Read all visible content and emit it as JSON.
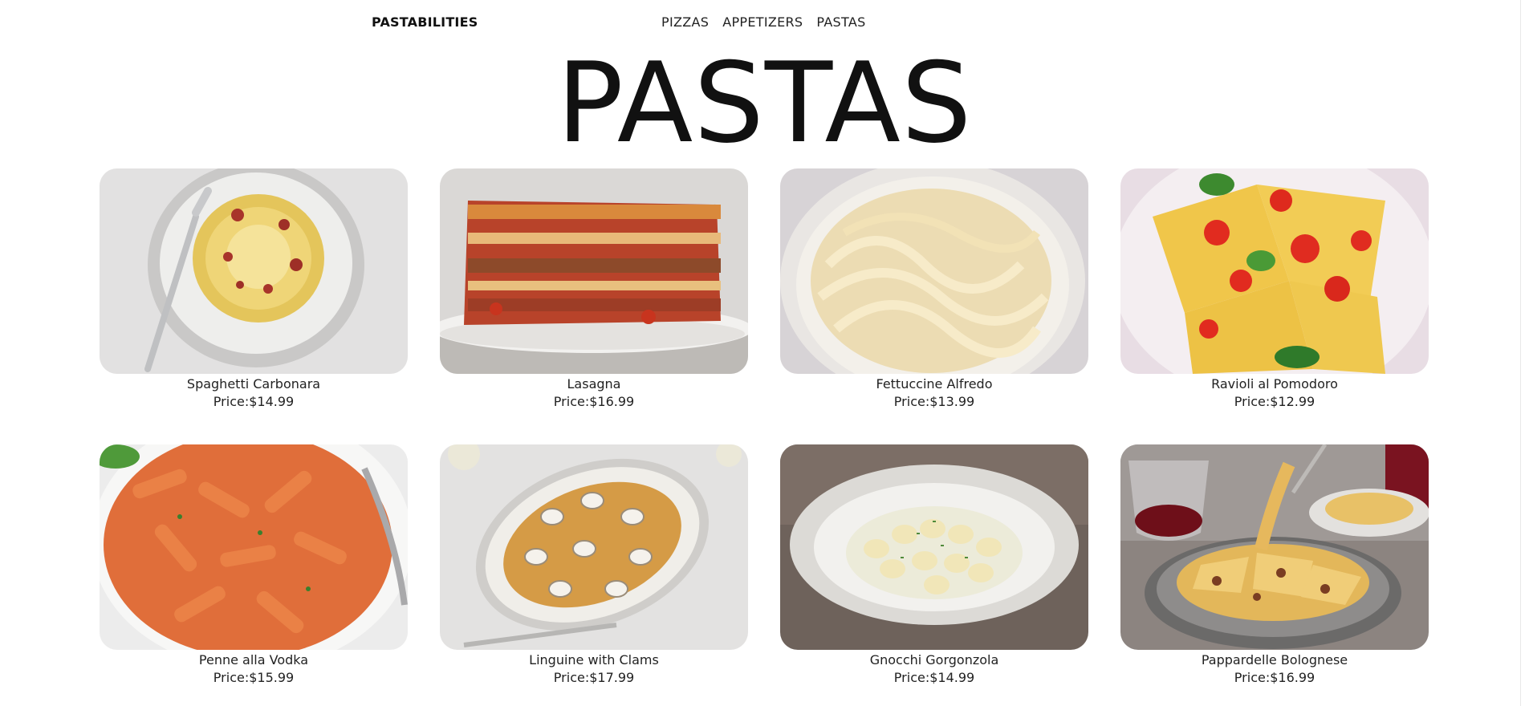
{
  "nav": {
    "brand": "PASTABILITIES",
    "links": [
      "PIZZAS",
      "APPETIZERS",
      "PASTAS"
    ]
  },
  "page": {
    "title": "PASTAS"
  },
  "dishes": [
    {
      "name": "Spaghetti Carbonara",
      "price": "Price:$14.99",
      "image": "spaghetti-carbonara-photo"
    },
    {
      "name": "Lasagna",
      "price": "Price:$16.99",
      "image": "lasagna-photo"
    },
    {
      "name": "Fettuccine Alfredo",
      "price": "Price:$13.99",
      "image": "fettuccine-alfredo-photo"
    },
    {
      "name": "Ravioli al Pomodoro",
      "price": "Price:$12.99",
      "image": "ravioli-pomodoro-photo"
    },
    {
      "name": "Penne alla Vodka",
      "price": "Price:$15.99",
      "image": "penne-vodka-photo"
    },
    {
      "name": "Linguine with Clams",
      "price": "Price:$17.99",
      "image": "linguine-clams-photo"
    },
    {
      "name": "Gnocchi Gorgonzola",
      "price": "Price:$14.99",
      "image": "gnocchi-gorgonzola-photo"
    },
    {
      "name": "Pappardelle Bolognese",
      "price": "Price:$16.99",
      "image": "pappardelle-bolognese-photo"
    }
  ]
}
